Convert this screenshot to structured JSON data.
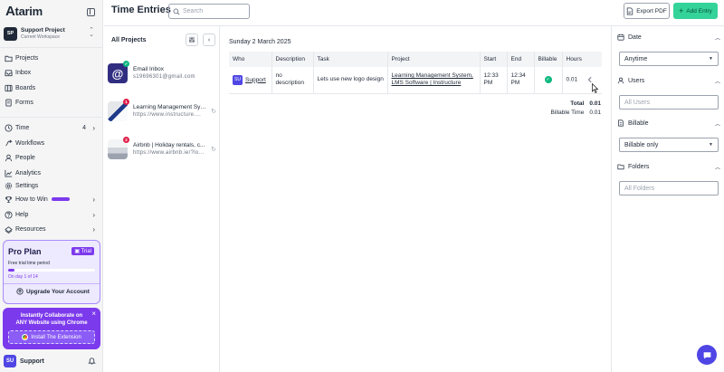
{
  "app": {
    "logo_text": "tarim",
    "logo_mark": "A"
  },
  "workspace": {
    "initials": "SP",
    "name": "Support Project",
    "subtitle": "Current Workspace"
  },
  "nav": {
    "items": [
      {
        "label": "Projects",
        "icon": "folder-icon"
      },
      {
        "label": "Inbox",
        "icon": "inbox-icon"
      },
      {
        "label": "Boards",
        "icon": "boards-icon"
      },
      {
        "label": "Forms",
        "icon": "forms-icon"
      }
    ],
    "time": {
      "label": "Time",
      "count": "4"
    },
    "items2": [
      {
        "label": "Workflows"
      },
      {
        "label": "People"
      },
      {
        "label": "Analytics"
      },
      {
        "label": "Settings"
      }
    ],
    "how_to_win": "How to Win",
    "help": "Help",
    "resources": "Resources"
  },
  "pro_card": {
    "title": "Pro Plan",
    "badge": "Trial",
    "subtitle": "Free trial time period",
    "progress_fraction": 0.07,
    "day_text": "On day 1 of 14",
    "upgrade": "Upgrade Your Account"
  },
  "extension_card": {
    "line1": "Instantly Collaborate on",
    "line2": "ANY Website using Chrome",
    "button": "Install The Extension"
  },
  "user": {
    "initials": "SU",
    "name": "Support"
  },
  "header": {
    "title": "Time Entries",
    "search_placeholder": "Search",
    "export_label": "Export PDF",
    "add_label": "Add Entry"
  },
  "projects_panel": {
    "title": "All Projects",
    "items": [
      {
        "name": "Email Inbox",
        "url": "s19696301@gmail.com",
        "badge": ""
      },
      {
        "name": "Learning Management Sys...",
        "url": "https://www.instructure....",
        "badge": "1"
      },
      {
        "name": "Airbnb | Holiday rentals, c...",
        "url": "https://www.airbnb.ie/?lo...",
        "badge": "2"
      }
    ]
  },
  "entries": {
    "date_heading": "Sunday 2 March 2025",
    "columns": [
      "Who",
      "Description",
      "Task",
      "Project",
      "Start",
      "End",
      "Billable",
      "Hours"
    ],
    "rows": [
      {
        "who_initials": "SU",
        "who": "Support",
        "description_line1": "no",
        "description_line2": "description",
        "task": "Lets use new logo design",
        "project_line1": "Learning Management System,",
        "project_line2": "LMS Software | Instructure",
        "start_line1": "12:33",
        "start_line2": "PM",
        "end_line1": "12:34",
        "end_line2": "PM",
        "billable": true,
        "hours": "0.01"
      }
    ],
    "total_label": "Total",
    "total_value": "0.01",
    "billable_label": "Billable Time",
    "billable_value": "0.01"
  },
  "filters": {
    "date": {
      "label": "Date",
      "value": "Anytime"
    },
    "users": {
      "label": "Users",
      "placeholder": "All Users"
    },
    "billable": {
      "label": "Billable",
      "value": "Billable only"
    },
    "folders": {
      "label": "Folders",
      "placeholder": "All Folders"
    }
  },
  "colors": {
    "accent": "#7c3aed",
    "add_button": "#34d399",
    "avatar": "#4f46e5",
    "billable": "#10b981"
  }
}
